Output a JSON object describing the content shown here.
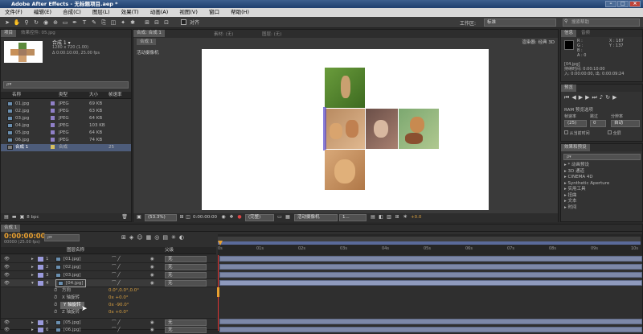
{
  "app": {
    "title": "Adobe After Effects - 无标题项目.aep *"
  },
  "menu": [
    "文件(F)",
    "编辑(E)",
    "合成(C)",
    "图层(L)",
    "效果(T)",
    "动画(A)",
    "视图(V)",
    "窗口",
    "帮助(H)"
  ],
  "toolbar": {
    "align_label": "对齐",
    "workspace_label": "工作区:",
    "workspace_value": "标准",
    "search_placeholder": "搜索帮助"
  },
  "project": {
    "tab": "项目",
    "tab2": "效果控件: 05.jpg",
    "comp_name": "合成 1 ▾",
    "comp_size": "1280 x 720 (1.00)",
    "comp_duration": "Δ 0:00:10:00, 25.00 fps",
    "search_placeholder": "ρ▾",
    "columns": [
      "名称",
      "类型",
      "大小",
      "帧速率"
    ],
    "items": [
      {
        "name": "01.jpg",
        "type": "JPEG",
        "size": "69 KB",
        "fps": ""
      },
      {
        "name": "02.jpg",
        "type": "JPEG",
        "size": "63 KB",
        "fps": ""
      },
      {
        "name": "03.jpg",
        "type": "JPEG",
        "size": "64 KB",
        "fps": ""
      },
      {
        "name": "04.jpg",
        "type": "JPEG",
        "size": "103 KB",
        "fps": ""
      },
      {
        "name": "05.jpg",
        "type": "JPEG",
        "size": "64 KB",
        "fps": ""
      },
      {
        "name": "06.jpg",
        "type": "JPEG",
        "size": "74 KB",
        "fps": ""
      },
      {
        "name": "合成 1",
        "type": "合成",
        "size": "",
        "fps": "25"
      }
    ],
    "bpc": "8 bpc"
  },
  "comp": {
    "tab": "合成: 合成 1",
    "tab_sub": "合成 1",
    "footage_tab": "素材: (无)",
    "layer_tab": "图层: (无)",
    "renderer": "渲染器: 经典 3D",
    "view_label": "活动摄像机",
    "zoom": "(53.3%)",
    "timecode": "0:00:00:00",
    "resolution": "(完整)",
    "camera": "活动摄像机",
    "views": "1...",
    "exposure": "+0.0"
  },
  "info": {
    "tab": "信息",
    "tab2": "音频",
    "rgb": [
      "R :",
      "G :",
      "B :",
      "A : 0"
    ],
    "xy": [
      "X : 187",
      "Y : 137"
    ],
    "file": "[04.jpg]",
    "duration": "持续时间: 0:00:10:00",
    "inout": "入: 0:00:00:00, 出: 0:00:09:24"
  },
  "preview": {
    "tab": "预览",
    "ram_label": "RAM 预览选项",
    "fps_label": "帧速率",
    "skip_label": "跳过",
    "res_label": "分辨率",
    "fps_value": "(25)",
    "skip_value": "0",
    "res_value": "自动",
    "from_current": "从当前时间",
    "fullscreen": "全屏"
  },
  "effects": {
    "tab": "效果和预设",
    "search_placeholder": "ρ▾",
    "items": [
      "* 动画预设",
      "3D 通道",
      "CINEMA 4D",
      "Synthetic Aperture",
      "实用工具",
      "扭曲",
      "文本",
      "时间"
    ]
  },
  "timeline": {
    "tab": "合成 1",
    "timecode": "0:00:00:00",
    "frame_info": "00000 (25.00 fps)",
    "col_name": "图层名称",
    "col_parent": "父级",
    "ruler": [
      "0s",
      "01s",
      "02s",
      "03s",
      "04s",
      "05s",
      "06s",
      "07s",
      "08s",
      "09s",
      "10s"
    ],
    "layers": [
      {
        "num": "1",
        "name": "[01.jpg]",
        "parent": "无"
      },
      {
        "num": "2",
        "name": "[02.jpg]",
        "parent": "无"
      },
      {
        "num": "3",
        "name": "[03.jpg]",
        "parent": "无"
      },
      {
        "num": "4",
        "name": "[04.jpg]",
        "parent": "无"
      }
    ],
    "props": [
      {
        "name": "方向",
        "value": "0.0°,0.0°,0.0°"
      },
      {
        "name": "X 轴旋转",
        "value": "0x +0.0°"
      },
      {
        "name": "Y 轴旋转",
        "value": "0x -90.0°"
      },
      {
        "name": "Z 轴旋转",
        "value": "0x +0.0°"
      }
    ],
    "layers2": [
      {
        "num": "5",
        "name": "[05.jpg]",
        "parent": "无"
      },
      {
        "num": "6",
        "name": "[06.jpg]",
        "parent": "无"
      }
    ]
  }
}
